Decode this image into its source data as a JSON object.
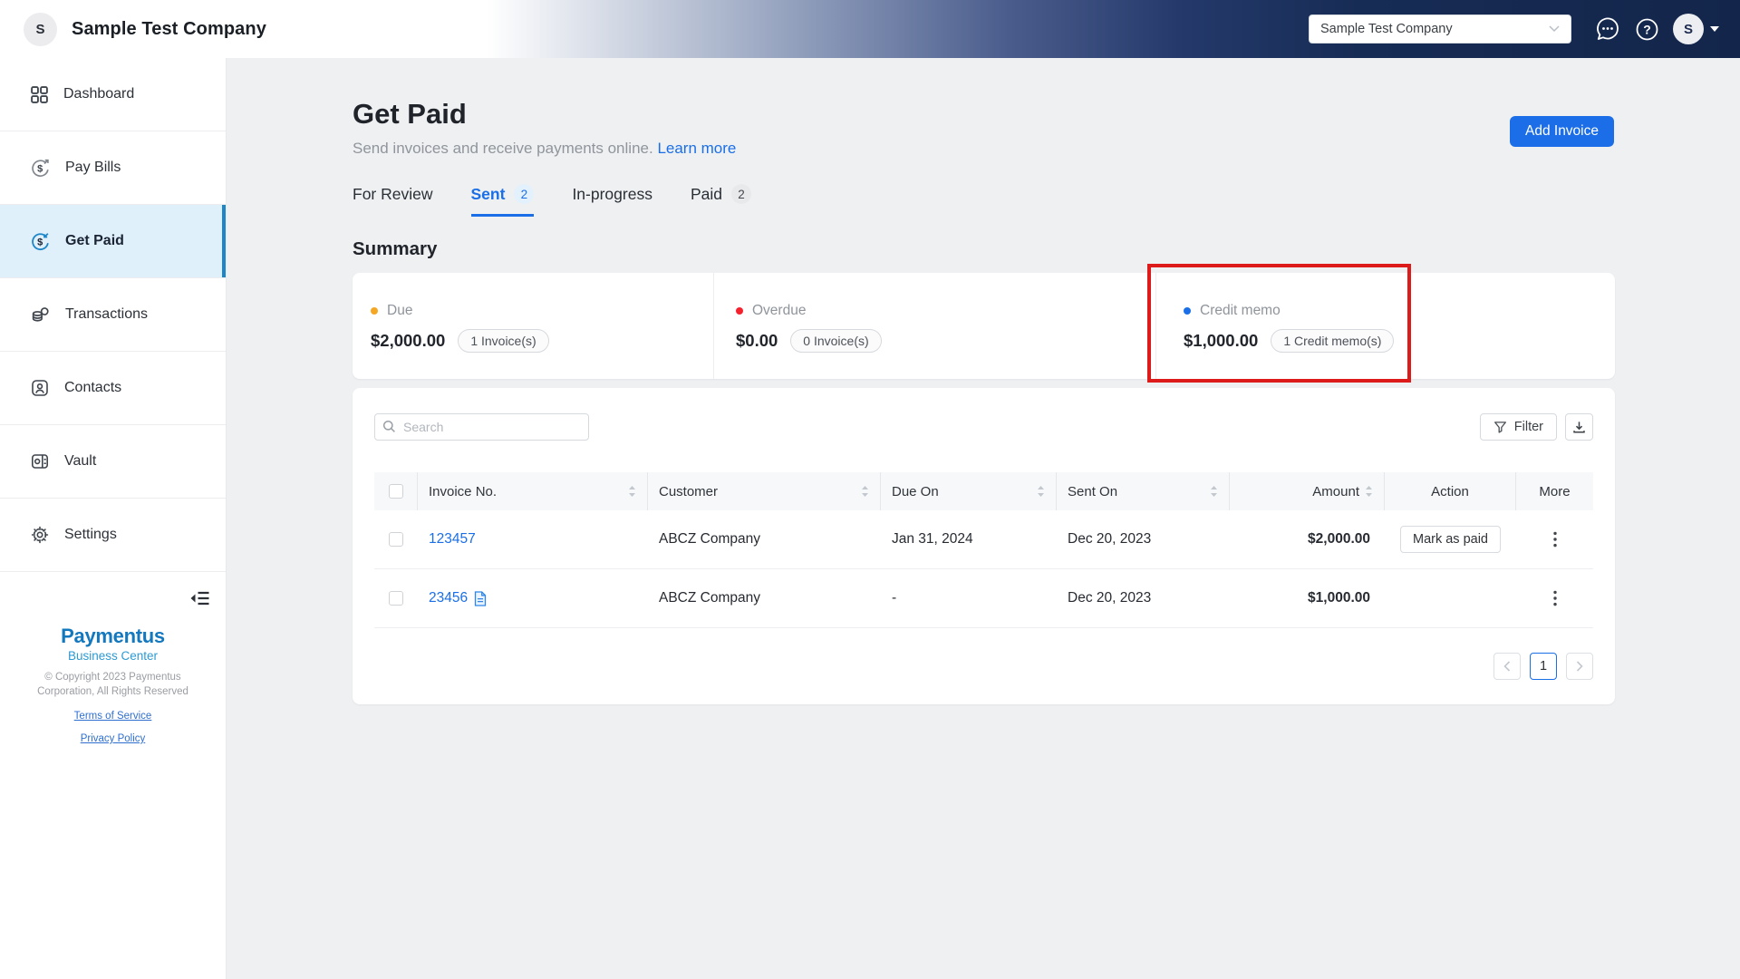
{
  "colors": {
    "accent_blue": "#1a6fe8",
    "annotation_red": "#de1b1b",
    "header_navy": "#13254a",
    "due_dot": "#f5a623",
    "overdue_dot": "#f5222d",
    "credit_memo_dot": "#1a6fe8",
    "logo_blue": "#1478be",
    "logo_light_blue": "#2e9ad2",
    "sidebar_active_bg": "#e0f0fa"
  },
  "header": {
    "company_name": "Sample Test Company",
    "company_avatar_initial": "S",
    "workspace_select_value": "Sample Test Company",
    "user_avatar_initial": "S"
  },
  "sidebar": {
    "items": [
      {
        "label": "Dashboard"
      },
      {
        "label": "Pay Bills"
      },
      {
        "label": "Get Paid",
        "active": true
      },
      {
        "label": "Transactions"
      },
      {
        "label": "Contacts"
      },
      {
        "label": "Vault"
      },
      {
        "label": "Settings"
      }
    ],
    "footer": {
      "brand_name": "Paymentus",
      "brand_subtitle": "Business Center",
      "copyright": "© Copyright 2023 Paymentus Corporation, All Rights Reserved",
      "terms_link": "Terms of Service",
      "privacy_link": "Privacy Policy"
    }
  },
  "page": {
    "title": "Get Paid",
    "subtitle": "Send invoices and receive payments online.",
    "learn_more_label": "Learn more",
    "add_invoice_label": "Add Invoice",
    "tabs": [
      {
        "label": "For Review"
      },
      {
        "label": "Sent",
        "badge": "2",
        "active": true
      },
      {
        "label": "In-progress"
      },
      {
        "label": "Paid",
        "badge": "2"
      }
    ]
  },
  "summary": {
    "heading": "Summary",
    "items": [
      {
        "label": "Due",
        "amount": "$2,000.00",
        "count": "1 Invoice(s)"
      },
      {
        "label": "Overdue",
        "amount": "$0.00",
        "count": "0 Invoice(s)"
      },
      {
        "label": "Credit memo",
        "amount": "$1,000.00",
        "count": "1 Credit memo(s)",
        "annotated": true
      }
    ]
  },
  "invoice_table": {
    "search_placeholder": "Search",
    "filter_label": "Filter",
    "columns": {
      "invoice_no": "Invoice No.",
      "customer": "Customer",
      "due_on": "Due On",
      "sent_on": "Sent On",
      "amount": "Amount",
      "action": "Action",
      "more": "More"
    },
    "rows": [
      {
        "invoice_no": "123457",
        "customer": "ABCZ Company",
        "due_on": "Jan 31, 2024",
        "sent_on": "Dec 20, 2023",
        "amount": "$2,000.00",
        "action": "Mark as paid"
      },
      {
        "invoice_no": "23456",
        "customer": "ABCZ Company",
        "due_on": "-",
        "sent_on": "Dec 20, 2023",
        "amount": "$1,000.00",
        "action": ""
      }
    ],
    "pagination": {
      "current_page": "1"
    }
  }
}
